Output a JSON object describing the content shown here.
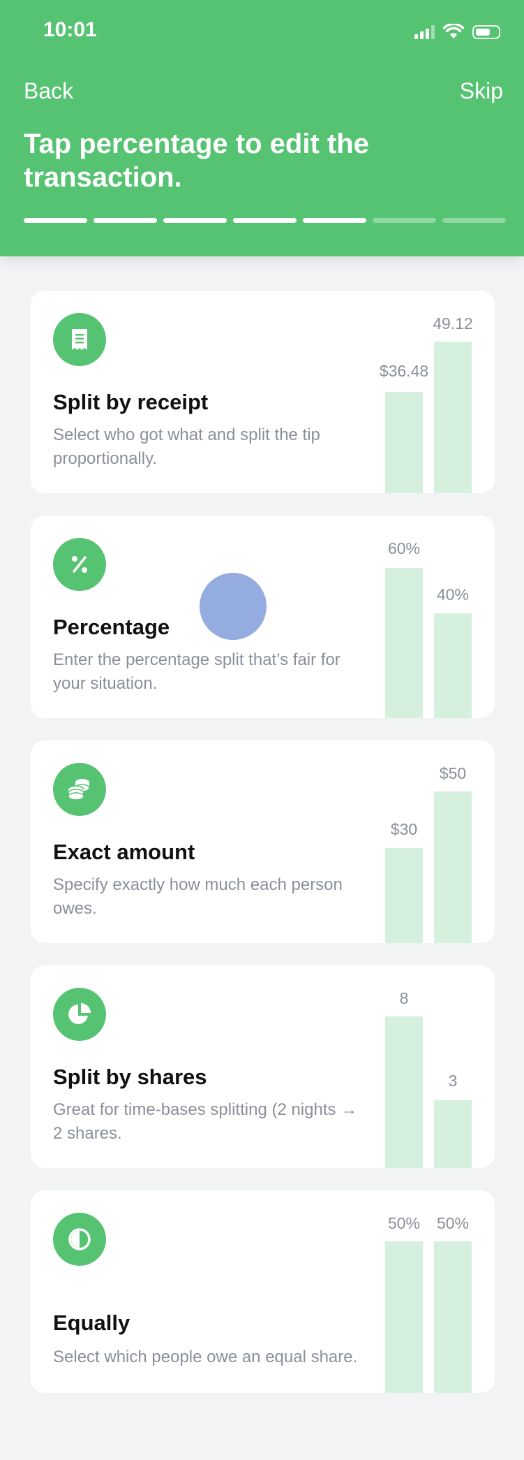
{
  "status": {
    "time": "10:01"
  },
  "nav": {
    "back": "Back",
    "skip": "Skip"
  },
  "header": {
    "title": "Tap percentage to edit the transaction."
  },
  "progress": {
    "completed": 5,
    "total": 7
  },
  "colors": {
    "accent": "#55c372",
    "bar": "#d5f0dc",
    "muted_text": "#8a8f99",
    "touch": "#94acdf"
  },
  "cards": [
    {
      "title": "Split by receipt",
      "icon": "receipt-icon",
      "description": "Select who got what and split the tip proportionally.",
      "bars": [
        {
          "label": "$36.48"
        },
        {
          "label": "49.12"
        }
      ]
    },
    {
      "title": "Percentage",
      "icon": "percent-icon",
      "description": "Enter the percentage split that’s fair for your situation.",
      "bars": [
        {
          "label": "60%"
        },
        {
          "label": "40%"
        }
      ]
    },
    {
      "title": "Exact amount",
      "icon": "coins-icon",
      "description": "Specify exactly how much each person owes.",
      "bars": [
        {
          "label": "$30"
        },
        {
          "label": "$50"
        }
      ]
    },
    {
      "title": "Split by shares",
      "icon": "pie-chart-icon",
      "description": "Great for time-bases splitting (2 nights → 2 shares.",
      "bars": [
        {
          "label": "8"
        },
        {
          "label": "3"
        }
      ]
    },
    {
      "title": "Equally",
      "icon": "half-circle-icon",
      "description": "Select which people owe an equal share.",
      "bars": [
        {
          "label": "50%"
        },
        {
          "label": "50%"
        }
      ]
    }
  ]
}
